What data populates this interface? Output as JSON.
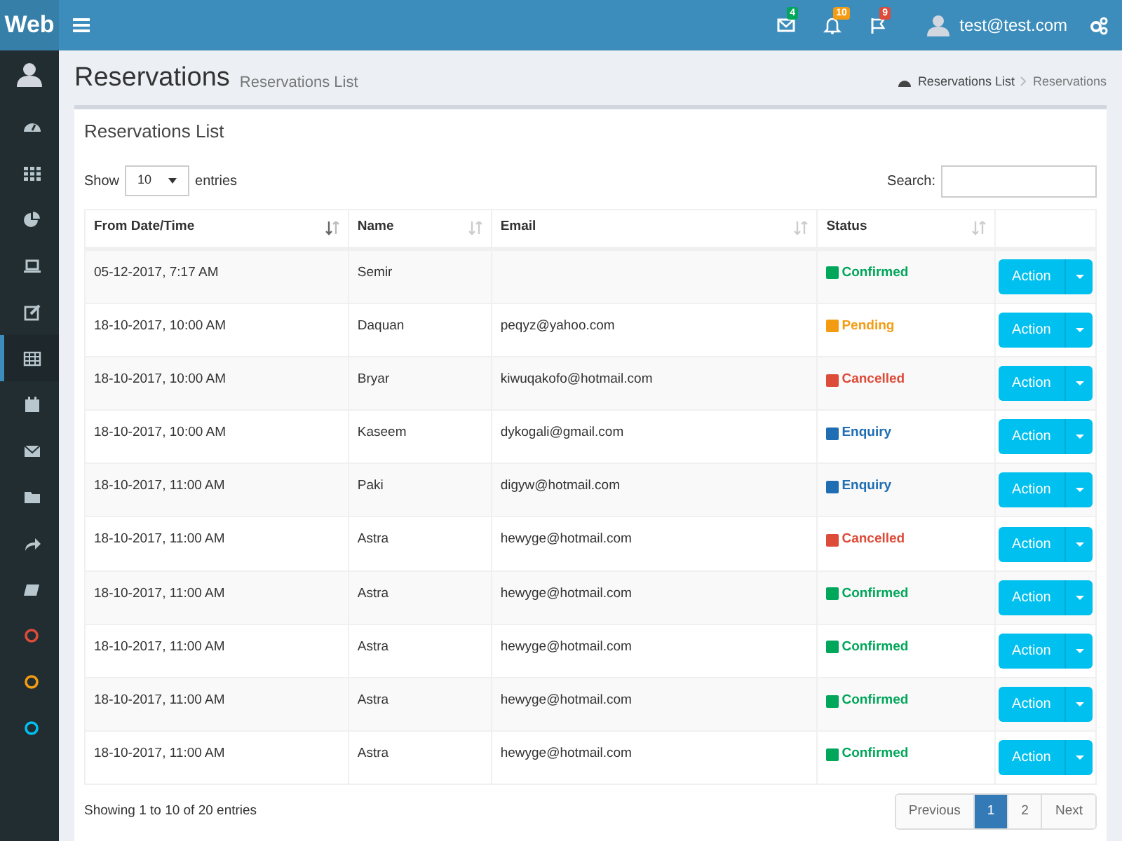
{
  "topbar": {
    "logo": "Web",
    "notifications": [
      {
        "count": "4",
        "color": "#00a65a"
      },
      {
        "count": "10",
        "color": "#f39c12"
      },
      {
        "count": "9",
        "color": "#dd4b39"
      }
    ],
    "user": "test@test.com"
  },
  "sidebar": {
    "items": [
      {
        "kind": "icon",
        "selected": false
      },
      {
        "kind": "icon",
        "selected": false
      },
      {
        "kind": "icon",
        "selected": false
      },
      {
        "kind": "icon",
        "selected": false
      },
      {
        "kind": "icon",
        "selected": false
      },
      {
        "kind": "icon",
        "selected": true
      },
      {
        "kind": "icon",
        "selected": false
      },
      {
        "kind": "icon",
        "selected": false
      },
      {
        "kind": "icon",
        "selected": false
      },
      {
        "kind": "icon",
        "selected": false
      },
      {
        "kind": "icon",
        "selected": false
      },
      {
        "kind": "circle",
        "selected": false,
        "color": "#dd4b39"
      },
      {
        "kind": "circle",
        "selected": false,
        "color": "#f39c12"
      },
      {
        "kind": "circle",
        "selected": false,
        "color": "#00c0ef"
      }
    ]
  },
  "header": {
    "title": "Reservations",
    "subtitle": "Reservations List",
    "breadcrumb": [
      "Reservations List",
      "Reservations"
    ]
  },
  "card": {
    "title": "Reservations List",
    "show_label": "Show",
    "page_size": "10",
    "entries_label": "entries",
    "search_label": "Search:",
    "table": {
      "columns": [
        {
          "label": "From Date/Time",
          "sorted": true
        },
        {
          "label": "Name",
          "sorted": false
        },
        {
          "label": "Email",
          "sorted": false
        },
        {
          "label": "Status",
          "sorted": false
        }
      ],
      "rows": [
        {
          "date": "05-12-2017, 7:17 AM",
          "name": "Semir",
          "email": "",
          "status": "Confirmed",
          "color": "#00a65a",
          "action": "Action"
        },
        {
          "date": "18-10-2017, 10:00 AM",
          "name": "Daquan",
          "email": "peqyz@yahoo.com",
          "status": "Pending",
          "color": "#f39c12",
          "action": "Action"
        },
        {
          "date": "18-10-2017, 10:00 AM",
          "name": "Bryar",
          "email": "kiwuqakofo@hotmail.com",
          "status": "Cancelled",
          "color": "#dd4b39",
          "action": "Action"
        },
        {
          "date": "18-10-2017, 10:00 AM",
          "name": "Kaseem",
          "email": "dykogali@gmail.com",
          "status": "Enquiry",
          "color": "#1f6db3",
          "action": "Action"
        },
        {
          "date": "18-10-2017, 11:00 AM",
          "name": "Paki",
          "email": "digyw@hotmail.com",
          "status": "Enquiry",
          "color": "#1f6db3",
          "action": "Action"
        },
        {
          "date": "18-10-2017, 11:00 AM",
          "name": "Astra",
          "email": "hewyge@hotmail.com",
          "status": "Cancelled",
          "color": "#dd4b39",
          "action": "Action"
        },
        {
          "date": "18-10-2017, 11:00 AM",
          "name": "Astra",
          "email": "hewyge@hotmail.com",
          "status": "Confirmed",
          "color": "#00a65a",
          "action": "Action"
        },
        {
          "date": "18-10-2017, 11:00 AM",
          "name": "Astra",
          "email": "hewyge@hotmail.com",
          "status": "Confirmed",
          "color": "#00a65a",
          "action": "Action"
        },
        {
          "date": "18-10-2017, 11:00 AM",
          "name": "Astra",
          "email": "hewyge@hotmail.com",
          "status": "Confirmed",
          "color": "#00a65a",
          "action": "Action"
        },
        {
          "date": "18-10-2017, 11:00 AM",
          "name": "Astra",
          "email": "hewyge@hotmail.com",
          "status": "Confirmed",
          "color": "#00a65a",
          "action": "Action"
        }
      ]
    },
    "info": "Showing 1 to 10 of 20 entries",
    "pagination": [
      {
        "label": "Previous",
        "selected": false
      },
      {
        "label": "1",
        "selected": true
      },
      {
        "label": "2",
        "selected": false
      },
      {
        "label": "Next",
        "selected": false
      }
    ]
  }
}
